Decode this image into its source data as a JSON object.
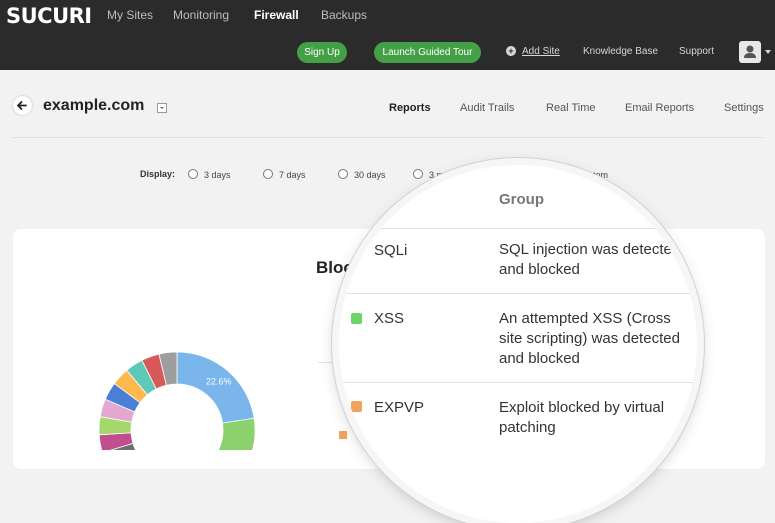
{
  "brand": {
    "logo_text": "SUCURI"
  },
  "topnav": {
    "links": [
      "My Sites",
      "Monitoring",
      "Firewall",
      "Backups"
    ],
    "active": "Firewall",
    "signup_label": "Sign Up",
    "tour_label": "Launch Guided Tour",
    "add_site_label": "Add Site",
    "knowledge_base_label": "Knowledge Base",
    "support_label": "Support"
  },
  "site": {
    "name": "example.com"
  },
  "tabs": [
    "Reports",
    "Audit Trails",
    "Real Time",
    "Email Reports",
    "Settings"
  ],
  "active_tab": "Reports",
  "display": {
    "label": "Display:",
    "options": [
      "3 days",
      "7 days",
      "30 days",
      "3 mont",
      "custom"
    ]
  },
  "card": {
    "title": "Bloc"
  },
  "magnifier": {
    "group_header": "Group",
    "rows": [
      {
        "code": "SQLi",
        "color": "",
        "desc": "SQL injection was detected and blocked"
      },
      {
        "code": "XSS",
        "color": "#6dd46a",
        "desc": "An attempted XSS (Cross site scripting) was detected and blocked"
      },
      {
        "code": "EXPVP",
        "color": "#f0a35c",
        "desc": "Exploit blocked by virtual patching"
      }
    ]
  },
  "chart_data": {
    "type": "pie",
    "slices": [
      {
        "label": "22.6%",
        "value": 22.6,
        "color": "#7ab6ec"
      },
      {
        "value": 10.6,
        "color": "#8bd16d"
      }
    ],
    "other_slice_colors": [
      "#3b3b3b",
      "#f0a35c",
      "#7e7ee8",
      "#ee6b87",
      "#e6d35e",
      "#3da8a5",
      "#f27c3b",
      "#8a5cc0",
      "#51b6e0",
      "#6f6f6f",
      "#c24e8f",
      "#a5d86a",
      "#e3a8d0",
      "#4b7fd6",
      "#ffb84d",
      "#5fc9b8",
      "#d65a5a",
      "#9e9e9e"
    ]
  },
  "colors": {
    "topnav_bg": "#2b2b2b",
    "accent_green": "#43a047",
    "page_bg": "#f2f2f2"
  }
}
